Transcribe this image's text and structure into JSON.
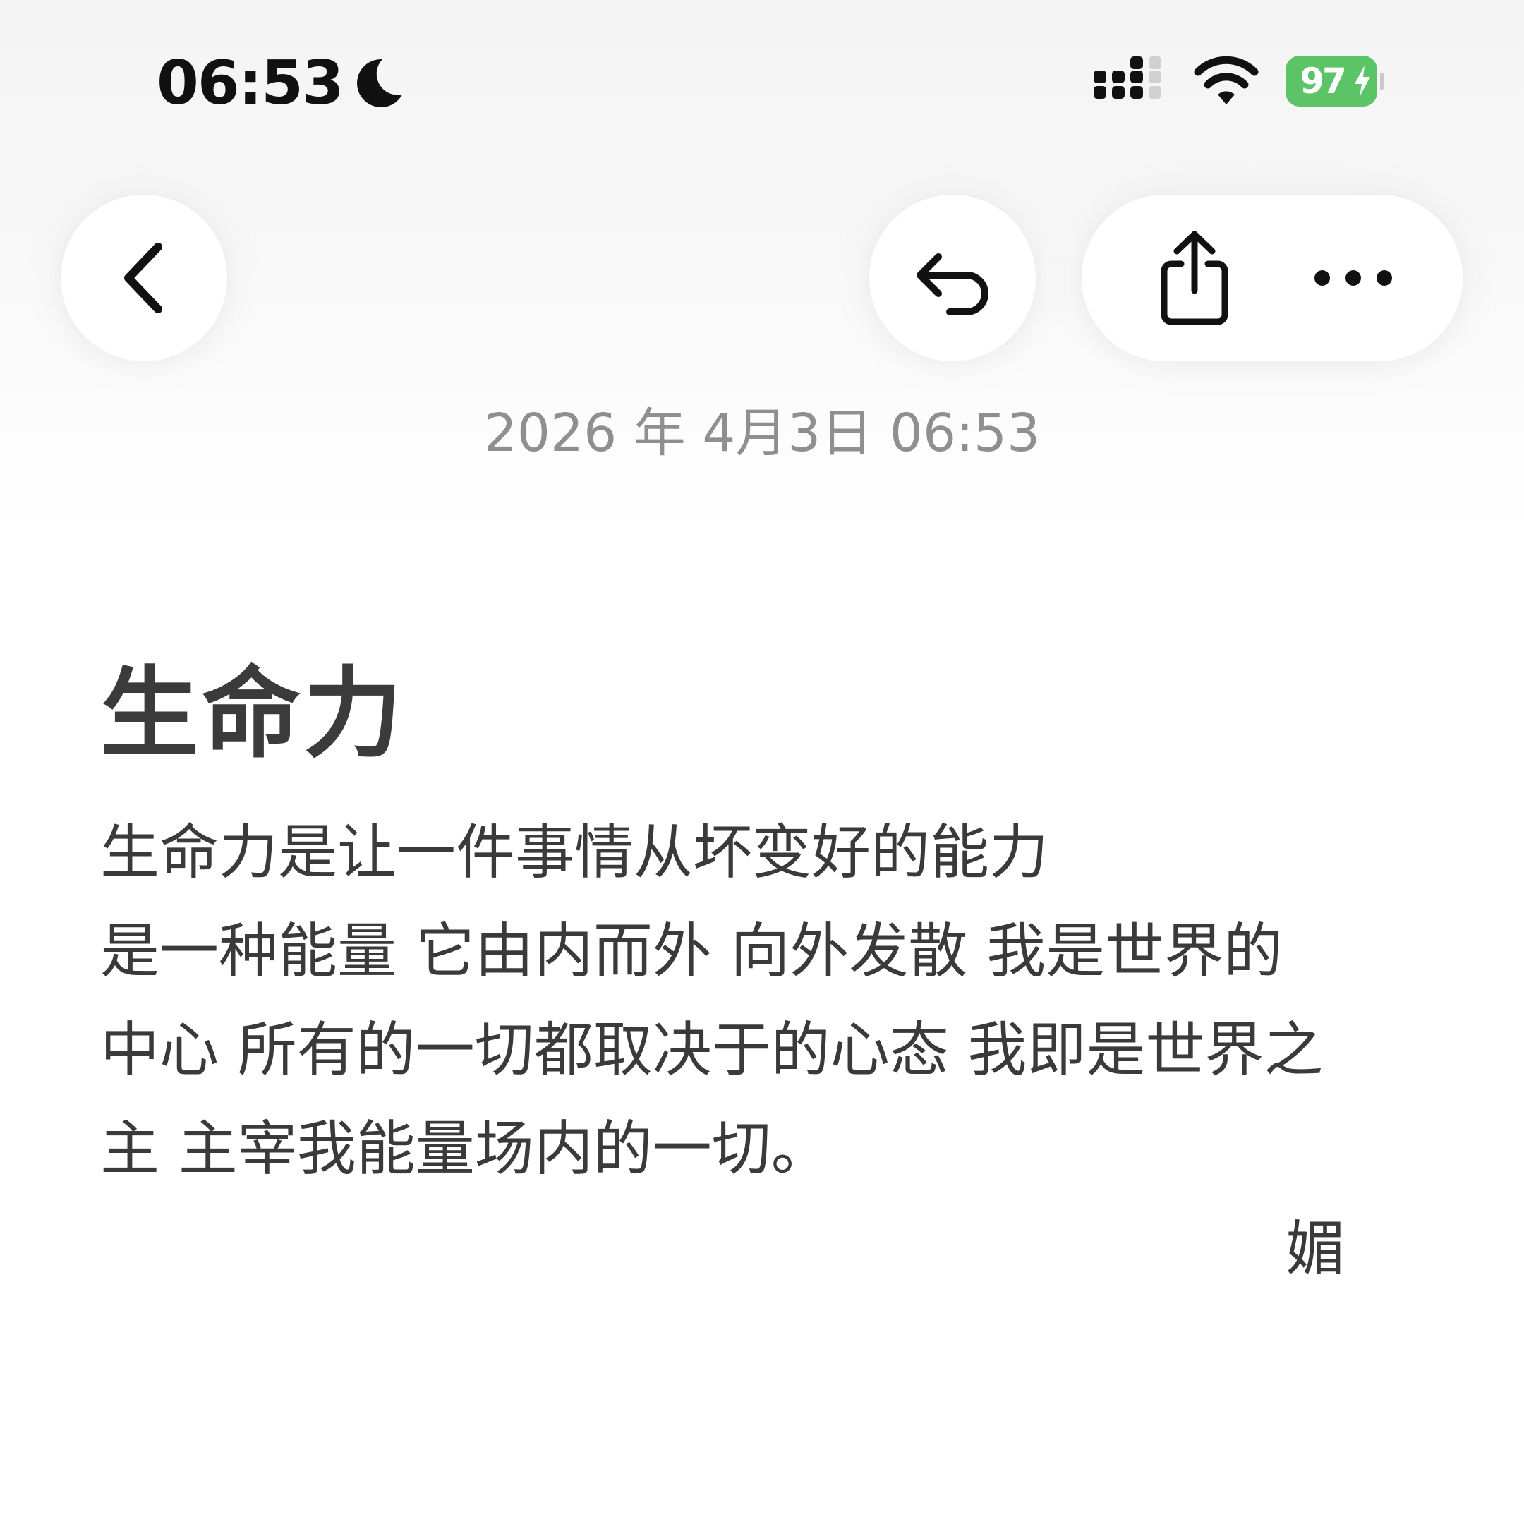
{
  "status_bar": {
    "time": "06:53",
    "focus_icon": "moon-icon",
    "signal_icon": "cellular-signal-icon",
    "wifi_icon": "wifi-icon",
    "battery_level": "97",
    "battery_charging": true,
    "battery_color": "#5ac466"
  },
  "toolbar": {
    "back_icon": "chevron-left-icon",
    "undo_icon": "undo-arrow-icon",
    "share_icon": "share-icon",
    "more_icon": "ellipsis-icon"
  },
  "note": {
    "date": "2026 年 4月3日 06:53",
    "title": "生命力",
    "lines": [
      "生命力是让一件事情从坏变好的能力",
      "是一种能量  它由内而外 向外发散 我是世界的",
      "中心 所有的一切都取决于的心态 我即是世界之",
      "主 主宰我能量场内的一切。"
    ],
    "signature": "媚"
  }
}
